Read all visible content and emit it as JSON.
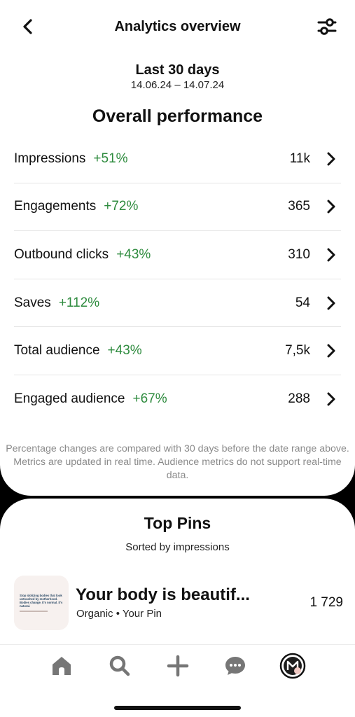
{
  "header": {
    "title": "Analytics overview",
    "back_icon": "chevron-left-icon",
    "filter_icon": "sliders-icon"
  },
  "period": {
    "title": "Last 30 days",
    "range": "14.06.24 – 14.07.24"
  },
  "overall": {
    "title": "Overall performance",
    "metrics": [
      {
        "name": "Impressions",
        "change": "+51%",
        "value": "11k"
      },
      {
        "name": "Engagements",
        "change": "+72%",
        "value": "365"
      },
      {
        "name": "Outbound clicks",
        "change": "+43%",
        "value": "310"
      },
      {
        "name": "Saves",
        "change": "+112%",
        "value": "54"
      },
      {
        "name": "Total audience",
        "change": "+43%",
        "value": "7,5k"
      },
      {
        "name": "Engaged audience",
        "change": "+67%",
        "value": "288"
      }
    ],
    "footnote": "Percentage changes are compared with 30 days before the date range above. Metrics are updated in real time. Audience metrics do not support real-time data."
  },
  "top_pins": {
    "title": "Top Pins",
    "subtitle": "Sorted by impressions",
    "pins": [
      {
        "title": "Your body is beautif...",
        "meta": "Organic • Your Pin",
        "count": "1 729",
        "thumb_text": "Stop idolizing bodies that look untouched by motherhood. Bodies change. It's normal. It's natural."
      }
    ]
  },
  "tabbar": {
    "items": [
      {
        "icon": "home-icon"
      },
      {
        "icon": "search-icon"
      },
      {
        "icon": "plus-icon"
      },
      {
        "icon": "chat-icon"
      },
      {
        "icon": "profile-avatar-icon"
      }
    ]
  },
  "colors": {
    "positive": "#2e8b3e",
    "background": "#000000",
    "card": "#ffffff",
    "muted": "#8a8a8a"
  }
}
